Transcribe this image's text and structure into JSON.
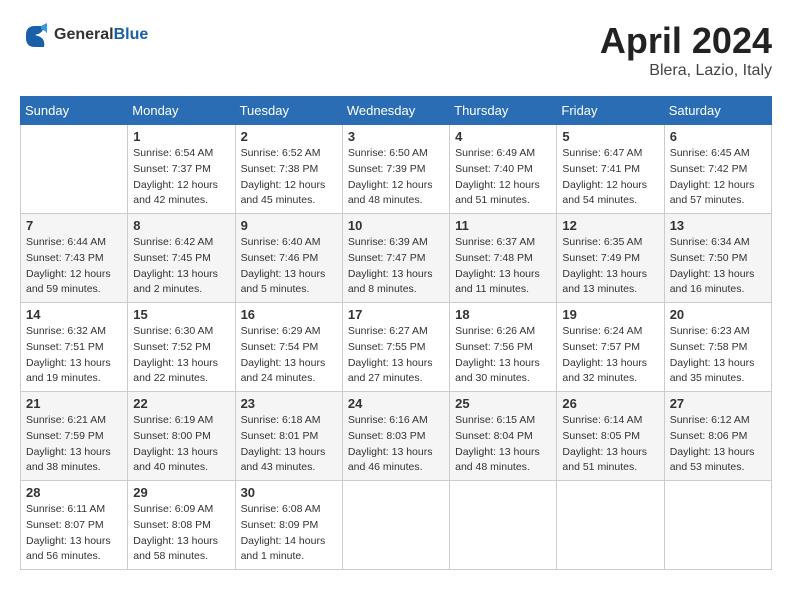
{
  "header": {
    "logo_line1": "General",
    "logo_line2": "Blue",
    "month": "April 2024",
    "location": "Blera, Lazio, Italy"
  },
  "weekdays": [
    "Sunday",
    "Monday",
    "Tuesday",
    "Wednesday",
    "Thursday",
    "Friday",
    "Saturday"
  ],
  "weeks": [
    [
      {
        "day": "",
        "sunrise": "",
        "sunset": "",
        "daylight": ""
      },
      {
        "day": "1",
        "sunrise": "Sunrise: 6:54 AM",
        "sunset": "Sunset: 7:37 PM",
        "daylight": "Daylight: 12 hours and 42 minutes."
      },
      {
        "day": "2",
        "sunrise": "Sunrise: 6:52 AM",
        "sunset": "Sunset: 7:38 PM",
        "daylight": "Daylight: 12 hours and 45 minutes."
      },
      {
        "day": "3",
        "sunrise": "Sunrise: 6:50 AM",
        "sunset": "Sunset: 7:39 PM",
        "daylight": "Daylight: 12 hours and 48 minutes."
      },
      {
        "day": "4",
        "sunrise": "Sunrise: 6:49 AM",
        "sunset": "Sunset: 7:40 PM",
        "daylight": "Daylight: 12 hours and 51 minutes."
      },
      {
        "day": "5",
        "sunrise": "Sunrise: 6:47 AM",
        "sunset": "Sunset: 7:41 PM",
        "daylight": "Daylight: 12 hours and 54 minutes."
      },
      {
        "day": "6",
        "sunrise": "Sunrise: 6:45 AM",
        "sunset": "Sunset: 7:42 PM",
        "daylight": "Daylight: 12 hours and 57 minutes."
      }
    ],
    [
      {
        "day": "7",
        "sunrise": "Sunrise: 6:44 AM",
        "sunset": "Sunset: 7:43 PM",
        "daylight": "Daylight: 12 hours and 59 minutes."
      },
      {
        "day": "8",
        "sunrise": "Sunrise: 6:42 AM",
        "sunset": "Sunset: 7:45 PM",
        "daylight": "Daylight: 13 hours and 2 minutes."
      },
      {
        "day": "9",
        "sunrise": "Sunrise: 6:40 AM",
        "sunset": "Sunset: 7:46 PM",
        "daylight": "Daylight: 13 hours and 5 minutes."
      },
      {
        "day": "10",
        "sunrise": "Sunrise: 6:39 AM",
        "sunset": "Sunset: 7:47 PM",
        "daylight": "Daylight: 13 hours and 8 minutes."
      },
      {
        "day": "11",
        "sunrise": "Sunrise: 6:37 AM",
        "sunset": "Sunset: 7:48 PM",
        "daylight": "Daylight: 13 hours and 11 minutes."
      },
      {
        "day": "12",
        "sunrise": "Sunrise: 6:35 AM",
        "sunset": "Sunset: 7:49 PM",
        "daylight": "Daylight: 13 hours and 13 minutes."
      },
      {
        "day": "13",
        "sunrise": "Sunrise: 6:34 AM",
        "sunset": "Sunset: 7:50 PM",
        "daylight": "Daylight: 13 hours and 16 minutes."
      }
    ],
    [
      {
        "day": "14",
        "sunrise": "Sunrise: 6:32 AM",
        "sunset": "Sunset: 7:51 PM",
        "daylight": "Daylight: 13 hours and 19 minutes."
      },
      {
        "day": "15",
        "sunrise": "Sunrise: 6:30 AM",
        "sunset": "Sunset: 7:52 PM",
        "daylight": "Daylight: 13 hours and 22 minutes."
      },
      {
        "day": "16",
        "sunrise": "Sunrise: 6:29 AM",
        "sunset": "Sunset: 7:54 PM",
        "daylight": "Daylight: 13 hours and 24 minutes."
      },
      {
        "day": "17",
        "sunrise": "Sunrise: 6:27 AM",
        "sunset": "Sunset: 7:55 PM",
        "daylight": "Daylight: 13 hours and 27 minutes."
      },
      {
        "day": "18",
        "sunrise": "Sunrise: 6:26 AM",
        "sunset": "Sunset: 7:56 PM",
        "daylight": "Daylight: 13 hours and 30 minutes."
      },
      {
        "day": "19",
        "sunrise": "Sunrise: 6:24 AM",
        "sunset": "Sunset: 7:57 PM",
        "daylight": "Daylight: 13 hours and 32 minutes."
      },
      {
        "day": "20",
        "sunrise": "Sunrise: 6:23 AM",
        "sunset": "Sunset: 7:58 PM",
        "daylight": "Daylight: 13 hours and 35 minutes."
      }
    ],
    [
      {
        "day": "21",
        "sunrise": "Sunrise: 6:21 AM",
        "sunset": "Sunset: 7:59 PM",
        "daylight": "Daylight: 13 hours and 38 minutes."
      },
      {
        "day": "22",
        "sunrise": "Sunrise: 6:19 AM",
        "sunset": "Sunset: 8:00 PM",
        "daylight": "Daylight: 13 hours and 40 minutes."
      },
      {
        "day": "23",
        "sunrise": "Sunrise: 6:18 AM",
        "sunset": "Sunset: 8:01 PM",
        "daylight": "Daylight: 13 hours and 43 minutes."
      },
      {
        "day": "24",
        "sunrise": "Sunrise: 6:16 AM",
        "sunset": "Sunset: 8:03 PM",
        "daylight": "Daylight: 13 hours and 46 minutes."
      },
      {
        "day": "25",
        "sunrise": "Sunrise: 6:15 AM",
        "sunset": "Sunset: 8:04 PM",
        "daylight": "Daylight: 13 hours and 48 minutes."
      },
      {
        "day": "26",
        "sunrise": "Sunrise: 6:14 AM",
        "sunset": "Sunset: 8:05 PM",
        "daylight": "Daylight: 13 hours and 51 minutes."
      },
      {
        "day": "27",
        "sunrise": "Sunrise: 6:12 AM",
        "sunset": "Sunset: 8:06 PM",
        "daylight": "Daylight: 13 hours and 53 minutes."
      }
    ],
    [
      {
        "day": "28",
        "sunrise": "Sunrise: 6:11 AM",
        "sunset": "Sunset: 8:07 PM",
        "daylight": "Daylight: 13 hours and 56 minutes."
      },
      {
        "day": "29",
        "sunrise": "Sunrise: 6:09 AM",
        "sunset": "Sunset: 8:08 PM",
        "daylight": "Daylight: 13 hours and 58 minutes."
      },
      {
        "day": "30",
        "sunrise": "Sunrise: 6:08 AM",
        "sunset": "Sunset: 8:09 PM",
        "daylight": "Daylight: 14 hours and 1 minute."
      },
      {
        "day": "",
        "sunrise": "",
        "sunset": "",
        "daylight": ""
      },
      {
        "day": "",
        "sunrise": "",
        "sunset": "",
        "daylight": ""
      },
      {
        "day": "",
        "sunrise": "",
        "sunset": "",
        "daylight": ""
      },
      {
        "day": "",
        "sunrise": "",
        "sunset": "",
        "daylight": ""
      }
    ]
  ]
}
